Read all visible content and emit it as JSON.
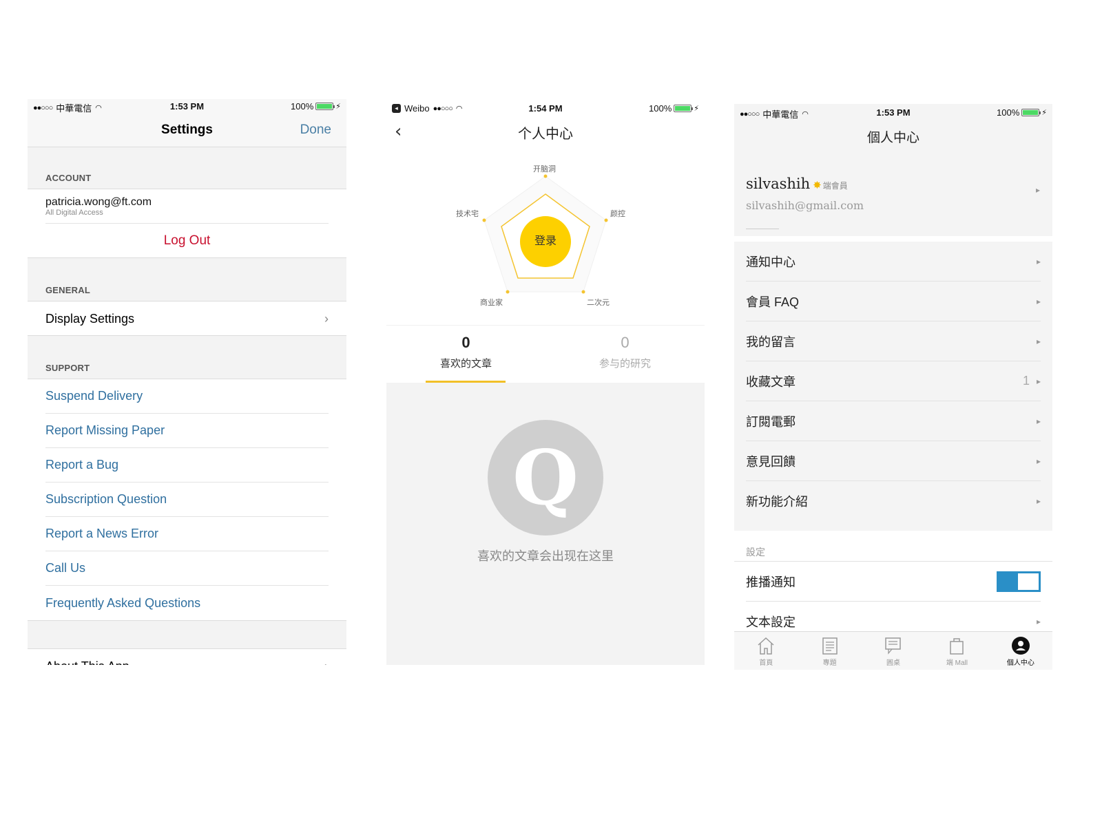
{
  "ft": {
    "status": {
      "carrier": "中華電信",
      "time": "1:53 PM",
      "battery": "100%"
    },
    "nav": {
      "title": "Settings",
      "done": "Done"
    },
    "account": {
      "header": "ACCOUNT",
      "email": "patricia.wong@ft.com",
      "subtitle": "All Digital Access",
      "logout": "Log Out"
    },
    "general": {
      "header": "GENERAL",
      "items": [
        "Display Settings"
      ]
    },
    "support": {
      "header": "SUPPORT",
      "items": [
        "Suspend Delivery",
        "Report Missing Paper",
        "Report a Bug",
        "Subscription Question",
        "Report a News Error",
        "Call Us",
        "Frequently Asked Questions"
      ]
    },
    "about": "About This App"
  },
  "weibo": {
    "status": {
      "app": "Weibo",
      "time": "1:54 PM",
      "battery": "100%"
    },
    "nav": {
      "title": "个人中心"
    },
    "radar_labels": [
      "开脑洞",
      "颜控",
      "二次元",
      "商业家",
      "技术宅"
    ],
    "login": "登录",
    "tabs": [
      {
        "count": "0",
        "label": "喜欢的文章"
      },
      {
        "count": "0",
        "label": "参与的研究"
      }
    ],
    "empty": {
      "icon_letter": "Q",
      "text": "喜欢的文章会出现在这里"
    }
  },
  "member": {
    "status": {
      "carrier": "中華電信",
      "time": "1:53 PM",
      "battery": "100%"
    },
    "nav": {
      "title": "個人中心"
    },
    "user": {
      "name": "silvashih",
      "tag": "端會員",
      "email": "silvashih@gmail.com"
    },
    "menu": [
      {
        "label": "通知中心"
      },
      {
        "label": "會員 FAQ"
      },
      {
        "label": "我的留言"
      },
      {
        "label": "收藏文章",
        "count": "1"
      },
      {
        "label": "訂閱電郵"
      },
      {
        "label": "意見回饋"
      },
      {
        "label": "新功能介紹"
      }
    ],
    "settings": {
      "header": "設定",
      "push": "推播通知",
      "push_on": true,
      "text_settings": "文本設定"
    },
    "tabbar": [
      "首頁",
      "專題",
      "圓桌",
      "端 Mall",
      "個人中心"
    ],
    "colors": {
      "accent": "#2a8fc7",
      "star": "#f2b800"
    }
  }
}
